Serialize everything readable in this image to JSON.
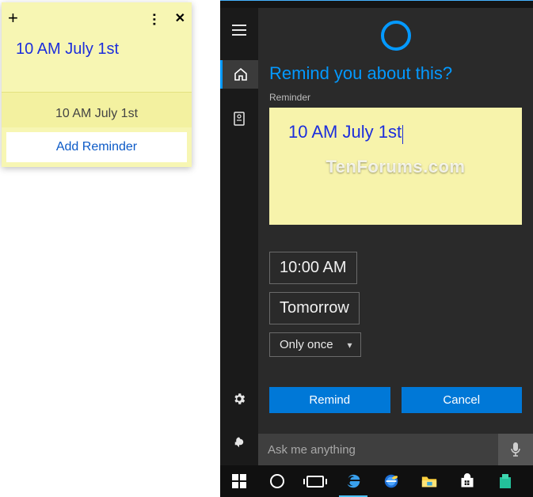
{
  "sticky": {
    "body": "10 AM July 1st",
    "hint": "10 AM July 1st",
    "addReminder": "Add Reminder"
  },
  "cortana": {
    "title": "Remind you about this?",
    "reminderLabel": "Reminder",
    "noteText": "10 AM July 1st",
    "watermark": "TenForums.com",
    "time": "10:00 AM",
    "day": "Tomorrow",
    "repeat": "Only once",
    "remindBtn": "Remind",
    "cancelBtn": "Cancel"
  },
  "search": {
    "placeholder": "Ask me anything"
  }
}
